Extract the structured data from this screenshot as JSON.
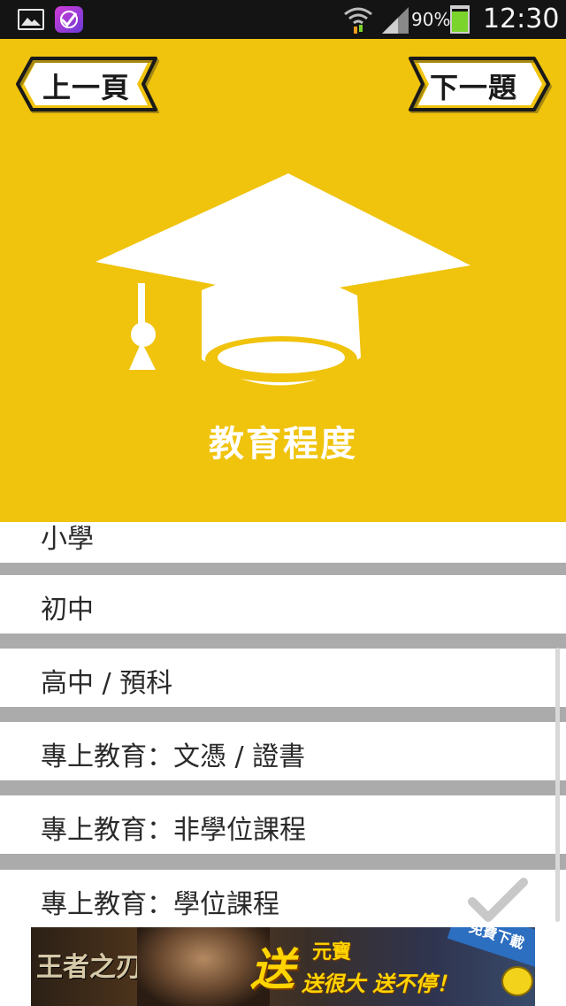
{
  "status_bar": {
    "battery_percent": "90%",
    "battery_level": 0.9,
    "time": "12:30",
    "icons": [
      "gallery-icon",
      "app-notification-icon",
      "wifi-icon",
      "signal-icon",
      "battery-icon"
    ]
  },
  "header": {
    "background_color": "#f0c30d",
    "prev_label": "上一頁",
    "next_label": "下一題",
    "title": "教育程度",
    "icon": "graduation-cap-icon"
  },
  "options": [
    {
      "label": "小學",
      "selected": false
    },
    {
      "label": "初中",
      "selected": false
    },
    {
      "label": "高中 / 預科",
      "selected": false
    },
    {
      "label": "專上教育：文憑 / 證書",
      "selected": false
    },
    {
      "label": "專上教育：非學位課程",
      "selected": false
    },
    {
      "label": "專上教育：學位課程",
      "selected": true
    }
  ],
  "ad": {
    "logo": "王者之刃",
    "headline": "送",
    "line1": "元寶",
    "line2": "送很大 送不停！",
    "corner_label": "免費下載"
  }
}
